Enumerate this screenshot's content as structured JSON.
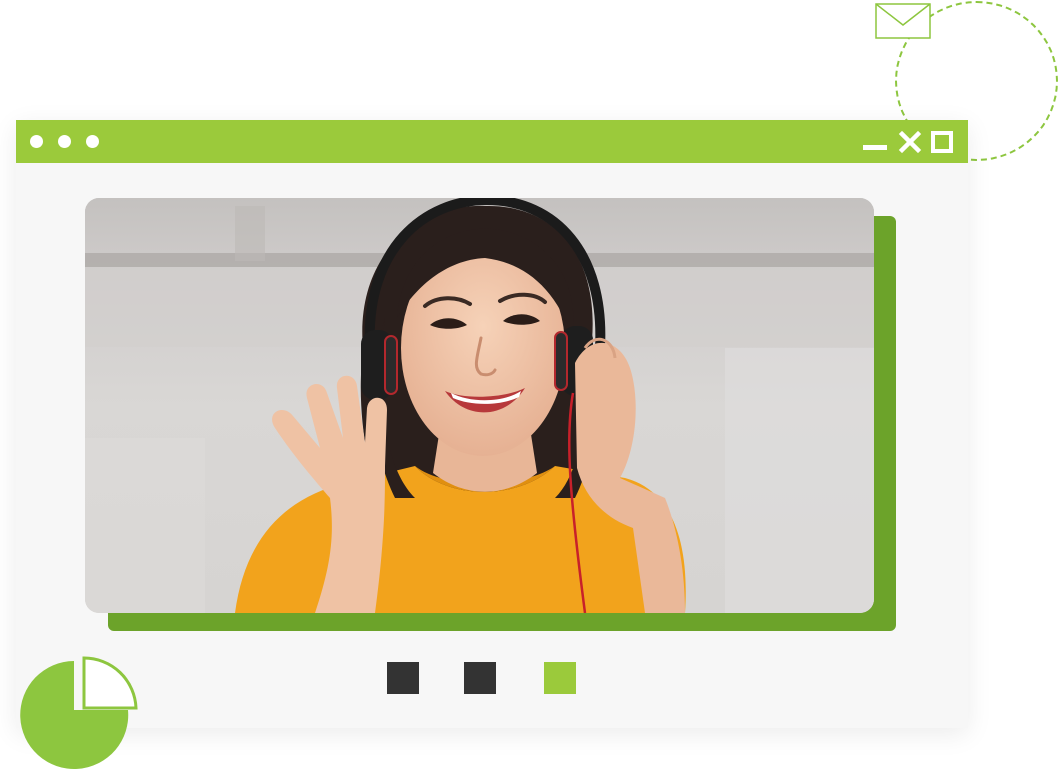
{
  "colors": {
    "accent": "#9bca3b",
    "accent_dark": "#6ca32a",
    "control_dark": "#333333",
    "window_bg": "#f7f7f7"
  },
  "window": {
    "titlebar_dots": [
      "dot",
      "dot",
      "dot"
    ],
    "controls": [
      "minimize-icon",
      "close-icon",
      "maximize-icon"
    ]
  },
  "video": {
    "content": "video-call-participant"
  },
  "call_controls": [
    {
      "name": "control-button-1",
      "color": "#333333"
    },
    {
      "name": "control-button-2",
      "color": "#333333"
    },
    {
      "name": "control-button-3",
      "color": "#9bca3b"
    }
  ],
  "decorations": [
    "mail-icon",
    "dashed-circle",
    "pie-chart-icon"
  ]
}
